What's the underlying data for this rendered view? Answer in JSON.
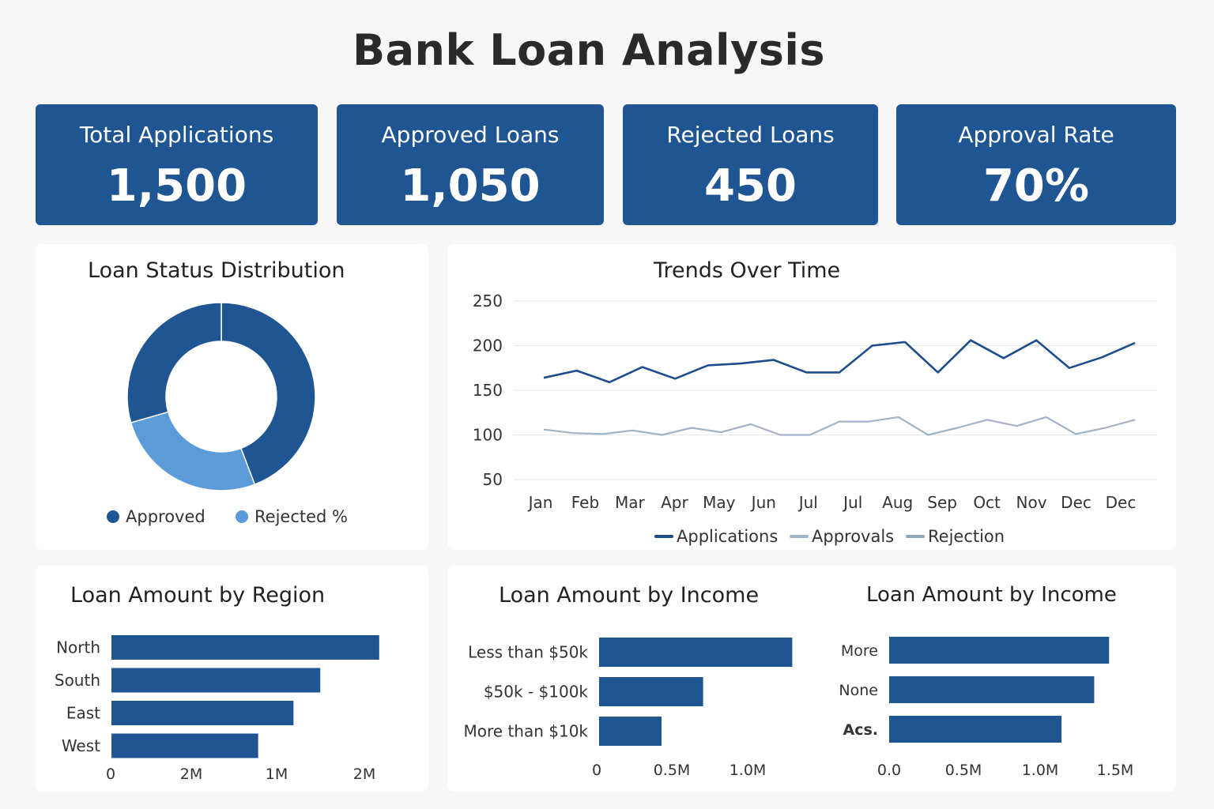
{
  "title": "Bank Loan Analysis",
  "kpis": [
    {
      "label": "Total Applications",
      "value": "1,500"
    },
    {
      "label": "Approved Loans",
      "value": "1,050"
    },
    {
      "label": "Rejected Loans",
      "value": "450"
    },
    {
      "label": "Approval Rate",
      "value": "70%"
    }
  ],
  "colors": {
    "primary": "#1e5592",
    "light": "#5b9bd8",
    "grey": "#a2b2c7",
    "grey2": "#93a6bd"
  },
  "chart_data": [
    {
      "type": "pie",
      "title": "Loan Status Distribution",
      "donut": true,
      "slices": [
        {
          "label": "Approved",
          "value": 70,
          "color": "#1e5592"
        },
        {
          "label": "Rejected",
          "value": 25,
          "color": "#5b9bd8"
        }
      ],
      "legend": [
        "Approved",
        "Rejected %"
      ]
    },
    {
      "type": "line",
      "title": "Trends Over Time",
      "categories": [
        "Jan",
        "Feb",
        "Mar",
        "Apr",
        "May",
        "Jun",
        "Jul",
        "Jul",
        "Aug",
        "Sep",
        "Oct",
        "Nov",
        "Dec",
        "Dec"
      ],
      "ylim": [
        50,
        250
      ],
      "yticks": [
        250,
        200,
        150,
        100,
        50
      ],
      "grid": true,
      "series": [
        {
          "name": "Applications",
          "color": "#1e4d8c",
          "x": [
            0,
            1,
            2,
            3,
            4,
            5,
            6,
            7,
            8,
            9,
            10,
            11,
            12,
            13,
            14,
            15,
            16,
            17,
            18
          ],
          "values": [
            164,
            172,
            159,
            176,
            163,
            178,
            180,
            184,
            170,
            170,
            200,
            204,
            170,
            206,
            186,
            206,
            175,
            187,
            203
          ]
        },
        {
          "name": "Approvals",
          "color": "#a2b2c7",
          "values": [
            106,
            102,
            101,
            105,
            100,
            108,
            103,
            112,
            100,
            100,
            115,
            115,
            120,
            100,
            108,
            117,
            110,
            120,
            101,
            108,
            117
          ]
        },
        {
          "name": "Rejection",
          "color": "#93a6bd",
          "values": []
        }
      ],
      "legend": [
        "Applications",
        "Approvals",
        "Rejection"
      ]
    },
    {
      "type": "bar",
      "orientation": "horizontal",
      "title": "Loan Amount by Region",
      "categories": [
        "North",
        "South",
        "East",
        "West"
      ],
      "values": [
        2.5,
        1.95,
        1.7,
        1.37
      ],
      "xticks": [
        "0",
        "2M",
        "1M",
        "2M"
      ]
    },
    {
      "type": "bar",
      "orientation": "horizontal",
      "title": "Loan Amount by Income",
      "categories": [
        "Less than $50k",
        "$50k - $100k",
        "More than $10k"
      ],
      "values": [
        1.3,
        0.7,
        0.42
      ],
      "xticks": [
        "0",
        "0.5M",
        "1.0M"
      ]
    },
    {
      "type": "bar",
      "orientation": "horizontal",
      "title": "Loan Amount by Income",
      "categories": [
        "More",
        "None",
        "Acs."
      ],
      "values": [
        1.48,
        1.38,
        1.16
      ],
      "xticks": [
        "0.0",
        "0.5M",
        "1.0M",
        "1.5M"
      ]
    }
  ]
}
